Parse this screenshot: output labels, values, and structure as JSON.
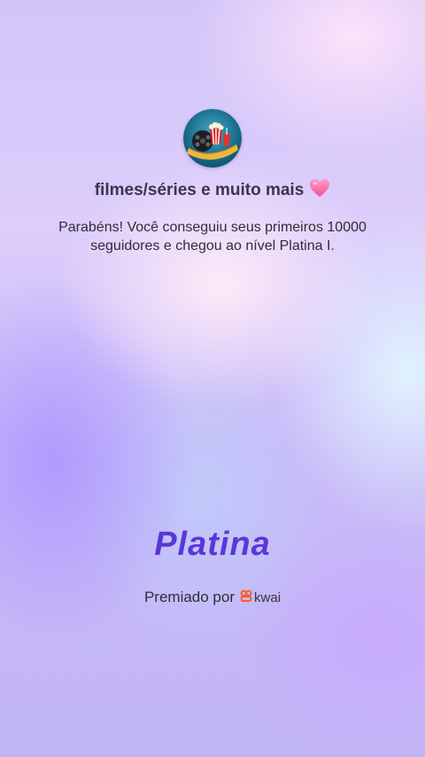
{
  "profile": {
    "avatar_icon": "movie-popcorn-avatar-icon",
    "title": "filmes/séries e muito mais",
    "title_emoji_icon": "pink-heart-icon"
  },
  "message": "Parabéns! Você conseguiu seus primeiros 10000 seguidores e chegou ao nível Platina I.",
  "level": {
    "label": "Platina",
    "color": "#5b37d6"
  },
  "footer": {
    "awarded_by": "Premiado por",
    "brand_name": "kwai",
    "brand_icon": "kwai-logo-icon",
    "brand_color": "#ff5a2a"
  }
}
